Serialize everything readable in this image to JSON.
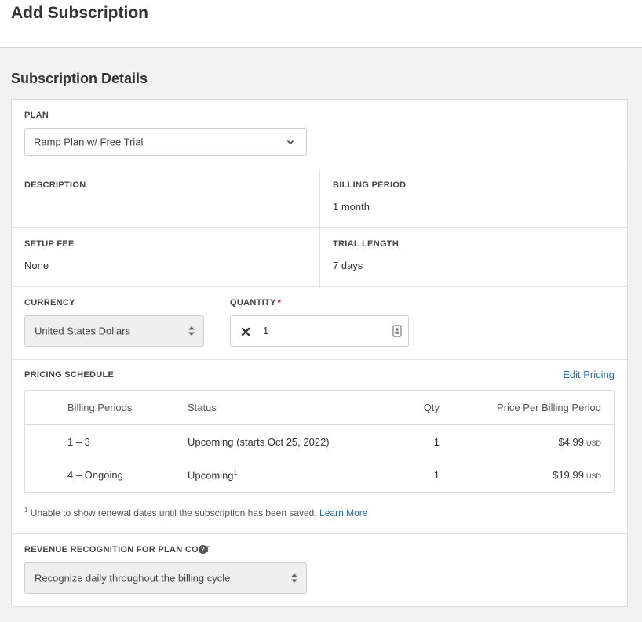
{
  "page": {
    "title": "Add Subscription"
  },
  "section": {
    "title": "Subscription Details"
  },
  "plan": {
    "label": "PLAN",
    "selected": "Ramp Plan w/ Free Trial"
  },
  "description": {
    "label": "DESCRIPTION",
    "value": ""
  },
  "billing_period": {
    "label": "BILLING PERIOD",
    "value": "1 month"
  },
  "setup_fee": {
    "label": "SETUP FEE",
    "value": "None"
  },
  "trial_length": {
    "label": "TRIAL LENGTH",
    "value": "7 days"
  },
  "currency": {
    "label": "CURRENCY",
    "selected": "United States Dollars"
  },
  "quantity": {
    "label": "QUANTITY",
    "required_mark": "*",
    "value": "1"
  },
  "pricing": {
    "label": "PRICING SCHEDULE",
    "edit_link": "Edit Pricing",
    "columns": [
      "Billing Periods",
      "Status",
      "Qty",
      "Price Per Billing Period"
    ],
    "rows": [
      {
        "periods": "1 – 3",
        "status": "Upcoming (starts Oct 25, 2022)",
        "status_sup": "",
        "qty": "1",
        "price": "$4.99",
        "unit": "USD"
      },
      {
        "periods": "4 – Ongoing",
        "status": "Upcoming",
        "status_sup": "1",
        "qty": "1",
        "price": "$19.99",
        "unit": "USD"
      }
    ],
    "footnote_marker": "1",
    "footnote_text": "Unable to show renewal dates until the subscription has been saved.",
    "footnote_link": "Learn More"
  },
  "revenue": {
    "label": "REVENUE RECOGNITION FOR PLAN COST",
    "help_icon": "?",
    "selected": "Recognize daily throughout the billing cycle"
  },
  "icons": {
    "plan_select": "chevron-down-icon",
    "currency_select": "updown-arrows-icon",
    "quantity_clear": "close-icon",
    "quantity_picker": "contact-card-icon",
    "revenue_help": "question-circle-icon",
    "revenue_select": "updown-arrows-icon"
  },
  "colors": {
    "link": "#1f6fb3",
    "required": "#d0021b",
    "background": "#f2f2f2"
  }
}
